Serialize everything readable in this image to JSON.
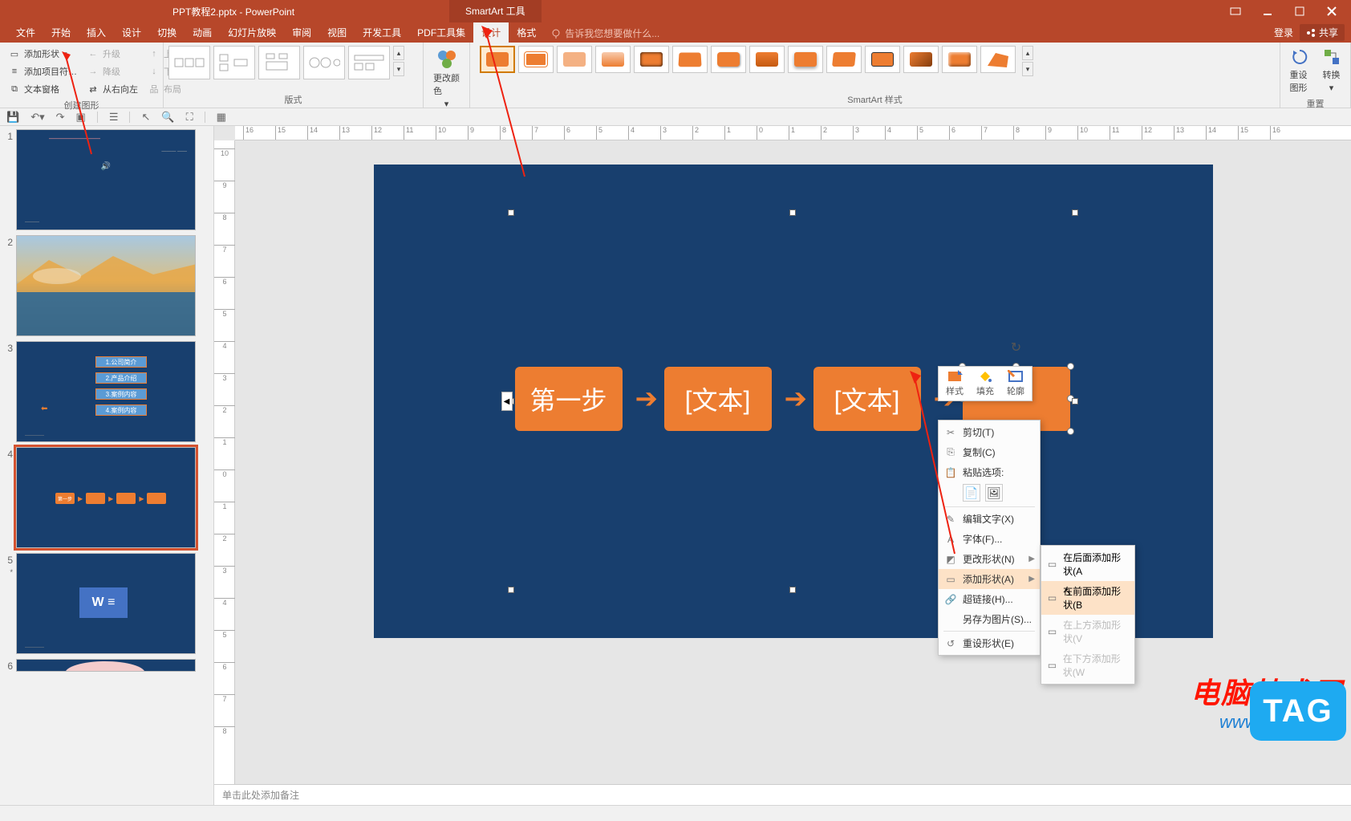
{
  "title": "PPT教程2.pptx - PowerPoint",
  "contextual_tab": "SmartArt 工具",
  "tabs": [
    "文件",
    "开始",
    "插入",
    "设计",
    "切换",
    "动画",
    "幻灯片放映",
    "审阅",
    "视图",
    "开发工具",
    "PDF工具集",
    "设计",
    "格式"
  ],
  "active_tab_index": 11,
  "tell_me_placeholder": "告诉我您想要做什么...",
  "login_label": "登录",
  "share_label": "共享",
  "ribbon": {
    "create": {
      "add_shape": "添加形状",
      "add_bullet": "添加项目符…",
      "text_pane": "文本窗格",
      "promote": "升级",
      "demote": "降级",
      "rtl": "从右向左",
      "move_up": "上移",
      "move_down": "下移",
      "layout": "布局",
      "label": "创建图形"
    },
    "layouts_label": "版式",
    "change_colors": "更改颜色",
    "styles_label": "SmartArt 样式",
    "reset": {
      "reset_graphic": "重设图形",
      "convert": "转换",
      "label": "重置"
    }
  },
  "thumbnails": {
    "numbers": [
      "1",
      "2",
      "3",
      "4",
      "5",
      "6"
    ],
    "slide3_items": [
      "1.公司简介",
      "2.产品介绍",
      "3.案例内容",
      "4.案例内容"
    ],
    "slide4_first": "第一步"
  },
  "canvas": {
    "node1": "第一步",
    "node2": "[文本]",
    "node3": "[文本]"
  },
  "mini_toolbar": {
    "style": "样式",
    "fill": "填充",
    "outline": "轮廓"
  },
  "context_menu": {
    "cut": "剪切(T)",
    "copy": "复制(C)",
    "paste_label": "粘贴选项:",
    "edit_text": "编辑文字(X)",
    "font": "字体(F)...",
    "change_shape": "更改形状(N)",
    "add_shape": "添加形状(A)",
    "hyperlink": "超链接(H)...",
    "save_as_pic": "另存为图片(S)...",
    "reset_shape": "重设形状(E)"
  },
  "submenu": {
    "add_after": "在后面添加形状(A",
    "add_before": "在前面添加形状(B",
    "add_above": "在上方添加形状(V",
    "add_below": "在下方添加形状(W"
  },
  "notes_placeholder": "单击此处添加备注",
  "watermark": {
    "red": "电脑技术网",
    "blue": "www.tagxp.com",
    "tag": "TAG"
  },
  "ruler_ticks_h": [
    "16",
    "15",
    "14",
    "13",
    "12",
    "11",
    "10",
    "9",
    "8",
    "7",
    "6",
    "5",
    "4",
    "3",
    "2",
    "1",
    "0",
    "1",
    "2",
    "3",
    "4",
    "5",
    "6",
    "7",
    "8",
    "9",
    "10",
    "11",
    "12",
    "13",
    "14",
    "15",
    "16"
  ],
  "ruler_ticks_v": [
    "10",
    "9",
    "8",
    "7",
    "6",
    "5",
    "4",
    "3",
    "2",
    "1",
    "0",
    "1",
    "2",
    "3",
    "4",
    "5",
    "6",
    "7",
    "8"
  ]
}
